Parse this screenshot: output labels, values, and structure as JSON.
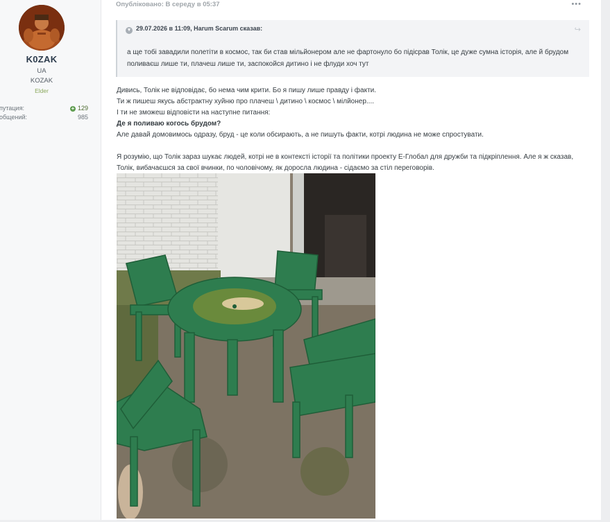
{
  "author": {
    "name": "K0ZAK",
    "country": "UA",
    "title": "KOZAK",
    "group": "Elder",
    "reputation_label": "епутация:",
    "reputation_value": "129",
    "posts_label": "ообщений:",
    "posts_value": "985"
  },
  "post": {
    "published": "Опубліковано: В середу в 05:37",
    "more_icon": "ellipsis-icon",
    "quote": {
      "header": "29.07.2026 в 11:09, Harum Scarum сказав:",
      "body": "а ще тобі завадили полетіти в космос, так би став мільйонером але не фартонуло бо підісрав Толік, це дуже сумна історія, але й брудом поливаєш лише ти, плачеш лише ти, заспокойся дитино і не флуди хоч тут"
    },
    "lines": [
      "Дивись, Толік не відповідає, бо нема чим крити. Бо я пишу лише правду і факти.",
      "Ти ж пишеш якусь абстрактну хуйню про плачеш \\ дитино \\ космос \\ мілйонер....",
      "І ти не зможеш відповісти на наступне питання:",
      "Де я поливаю когось брудом?",
      "Але давай домовимось одразу, бруд - це коли обсирають, а не пишуть факти, котрі людина не може спростувати."
    ],
    "paragraph2": "Я розумію, що Толік зараз шукає людей, котрі не в контексті історії та політики проекту Е-Глобал для дружби та підкріплення. Але я ж сказав, Толік, вибачаєшся за свої вчинки, по чоловічому, як доросла людина - сідаємо за стіл переговорів."
  },
  "colors": {
    "page_bg": "#edeef0",
    "author_bg": "#f7f8f9",
    "group": "#8aa85c",
    "quote_bg": "#f3f4f6",
    "furniture": "#2e7d4f"
  }
}
